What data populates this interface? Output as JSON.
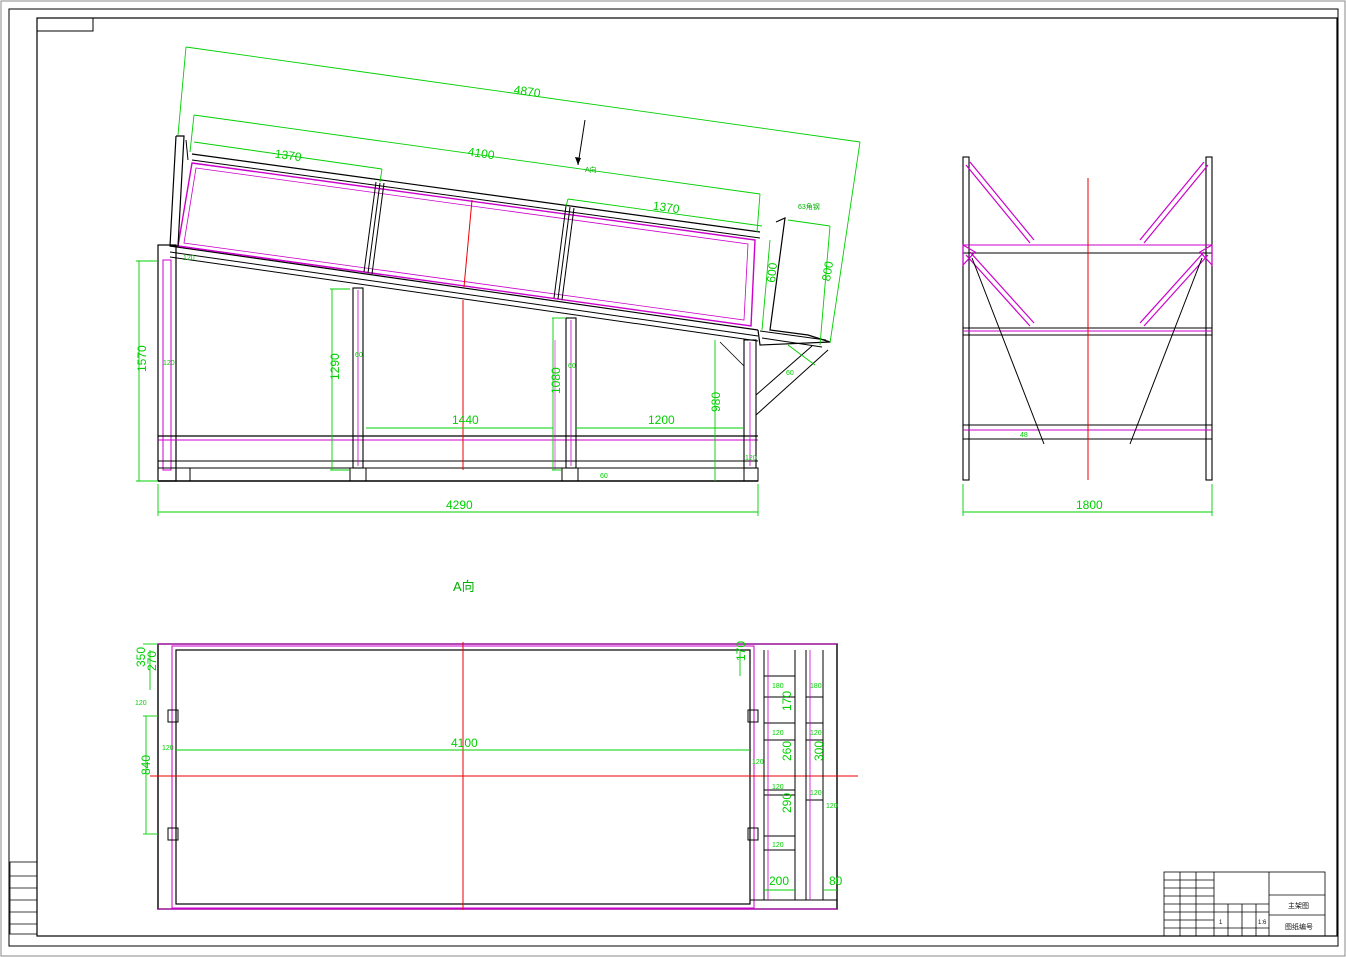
{
  "colors": {
    "outline": "#000000",
    "member": "#cc00cc",
    "dimension": "#00d000",
    "centerline": "#ee0000"
  },
  "side_view": {
    "dims": {
      "overall_length": "4870",
      "frame_length": "4100",
      "left_section": "1370",
      "right_section": "1370",
      "height_total": "1570",
      "left_post": "1290",
      "right_post": "1080",
      "end_post": "980",
      "span_left": "1440",
      "span_right": "1200",
      "base_length": "4290",
      "trough_depth": "800",
      "trough_inner": "600",
      "m120": "120",
      "m60": "60"
    },
    "view_arrow_label": "A向",
    "angle_note": "63角钢"
  },
  "end_view": {
    "width": "1800",
    "m48": "48"
  },
  "view_title": "A向",
  "plan_view": {
    "dims": {
      "length": "4100",
      "top_a": "350",
      "top_b": "270",
      "depth": "840",
      "r170a": "170",
      "r170b": "170",
      "r260": "260",
      "r290": "290",
      "r300": "300",
      "r200": "200",
      "r80": "80",
      "m120": "120",
      "m180": "180",
      "m120b": "120"
    }
  },
  "title_block": {
    "part_name": "主架图",
    "drawing_no": "图纸编号",
    "qty": "1",
    "scale": "1:6"
  }
}
